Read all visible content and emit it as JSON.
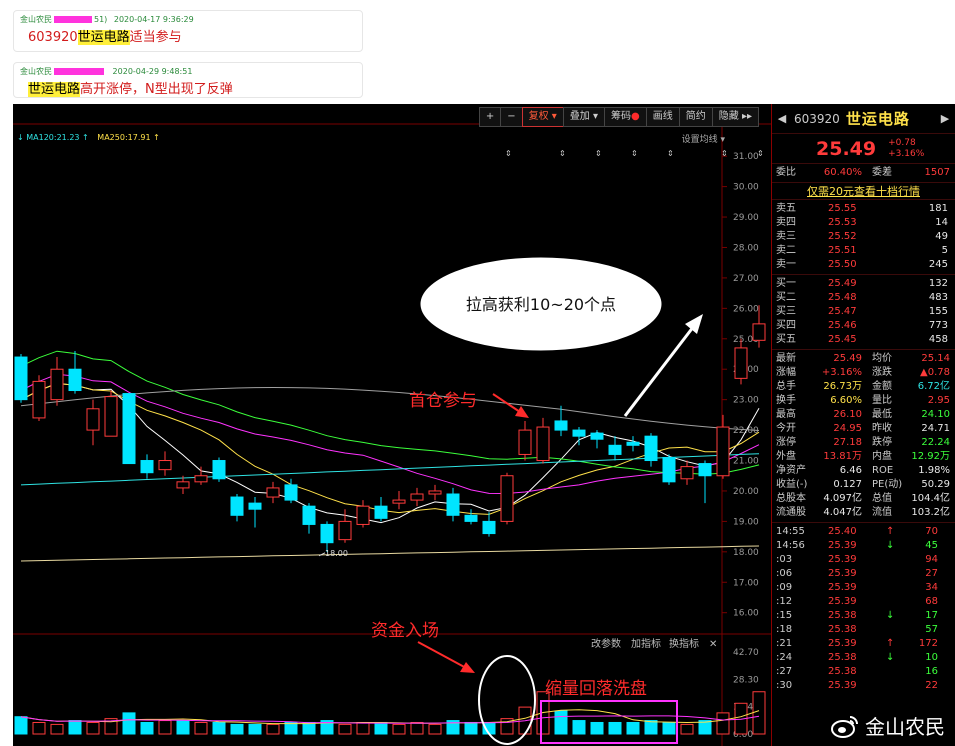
{
  "posts": [
    {
      "author": "金山农民",
      "author_suffix": "51)",
      "datetime": "2020-04-17 9:36:29",
      "code": "603920",
      "highlight": "世运电路",
      "rest": "适当参与"
    },
    {
      "author": "金山农民",
      "author_suffix": "",
      "datetime": "2020-04-29 9:48:51",
      "code": "",
      "highlight": "世运电路",
      "rest": "高开涨停，N型出现了反弹"
    }
  ],
  "toolbar": {
    "plus": "+",
    "minus": "−",
    "fuquan": "复权",
    "diejia": "叠加",
    "chouma": "筹码",
    "huaxian": "画线",
    "jianyue": "简约",
    "yincang": "隐藏"
  },
  "indicators": {
    "ma120": "MA120:21.23",
    "ma250": "MA250:17.91",
    "set_ma": "设置均线"
  },
  "sub_toolbar": {
    "change_params": "改参数",
    "add_indicator": "加指标",
    "switch_indicator": "换指标",
    "close": "✕"
  },
  "annotations": {
    "bubble": "拉高获利10~20个点",
    "first_position": "首仓参与",
    "capital_in": "资金入场",
    "shrink_volume": "缩量回落洗盘",
    "low_label": "18.00"
  },
  "chart_data": {
    "type": "candlestick",
    "price_axis_ticks": [
      "31.00",
      "30.00",
      "29.00",
      "28.00",
      "27.00",
      "26.00",
      "25.00",
      "24.00",
      "23.00",
      "22.00",
      "21.00",
      "20.00",
      "19.00",
      "18.00",
      "17.00",
      "16.00"
    ],
    "volume_axis_ticks": [
      "42.70",
      "28.30",
      "14.40",
      "0.00"
    ],
    "ylim": [
      15.3,
      31.4
    ],
    "candles": [
      {
        "o": 24.4,
        "c": 23.0,
        "h": 24.5,
        "l": 22.9
      },
      {
        "o": 22.4,
        "c": 23.6,
        "h": 23.8,
        "l": 22.3
      },
      {
        "o": 23.0,
        "c": 24.0,
        "h": 24.4,
        "l": 22.8
      },
      {
        "o": 24.0,
        "c": 23.3,
        "h": 24.6,
        "l": 23.2
      },
      {
        "o": 22.0,
        "c": 22.7,
        "h": 23.0,
        "l": 21.5
      },
      {
        "o": 21.8,
        "c": 23.1,
        "h": 23.3,
        "l": 21.8
      },
      {
        "o": 23.2,
        "c": 20.9,
        "h": 23.2,
        "l": 20.9
      },
      {
        "o": 21.0,
        "c": 20.6,
        "h": 21.2,
        "l": 20.4
      },
      {
        "o": 20.7,
        "c": 21.0,
        "h": 21.3,
        "l": 20.5
      },
      {
        "o": 20.1,
        "c": 20.3,
        "h": 20.5,
        "l": 19.9
      },
      {
        "o": 20.3,
        "c": 20.5,
        "h": 20.8,
        "l": 20.2
      },
      {
        "o": 21.0,
        "c": 20.4,
        "h": 21.1,
        "l": 20.3
      },
      {
        "o": 19.8,
        "c": 19.2,
        "h": 19.9,
        "l": 19.0
      },
      {
        "o": 19.6,
        "c": 19.4,
        "h": 19.8,
        "l": 18.8
      },
      {
        "o": 19.8,
        "c": 20.1,
        "h": 20.3,
        "l": 19.6
      },
      {
        "o": 20.2,
        "c": 19.7,
        "h": 20.4,
        "l": 19.6
      },
      {
        "o": 19.5,
        "c": 18.9,
        "h": 19.6,
        "l": 18.6
      },
      {
        "o": 18.9,
        "c": 18.3,
        "h": 19.0,
        "l": 18.0
      },
      {
        "o": 18.4,
        "c": 19.0,
        "h": 19.4,
        "l": 18.3
      },
      {
        "o": 18.9,
        "c": 19.5,
        "h": 19.7,
        "l": 18.8
      },
      {
        "o": 19.5,
        "c": 19.1,
        "h": 19.8,
        "l": 19.0
      },
      {
        "o": 19.6,
        "c": 19.7,
        "h": 20.0,
        "l": 19.4
      },
      {
        "o": 19.7,
        "c": 19.9,
        "h": 20.1,
        "l": 19.5
      },
      {
        "o": 19.9,
        "c": 20.0,
        "h": 20.2,
        "l": 19.7
      },
      {
        "o": 19.9,
        "c": 19.2,
        "h": 20.1,
        "l": 19.0
      },
      {
        "o": 19.2,
        "c": 19.0,
        "h": 19.4,
        "l": 18.9
      },
      {
        "o": 19.0,
        "c": 18.6,
        "h": 19.3,
        "l": 18.5
      },
      {
        "o": 19.0,
        "c": 20.5,
        "h": 20.6,
        "l": 18.9
      },
      {
        "o": 21.2,
        "c": 22.0,
        "h": 22.3,
        "l": 21.0
      },
      {
        "o": 21.0,
        "c": 22.1,
        "h": 22.4,
        "l": 20.9
      },
      {
        "o": 22.3,
        "c": 22.0,
        "h": 22.8,
        "l": 21.8
      },
      {
        "o": 22.0,
        "c": 21.8,
        "h": 22.1,
        "l": 21.5
      },
      {
        "o": 21.9,
        "c": 21.7,
        "h": 22.0,
        "l": 21.4
      },
      {
        "o": 21.5,
        "c": 21.2,
        "h": 21.8,
        "l": 21.0
      },
      {
        "o": 21.6,
        "c": 21.5,
        "h": 21.8,
        "l": 21.3
      },
      {
        "o": 21.8,
        "c": 21.0,
        "h": 21.9,
        "l": 20.8
      },
      {
        "o": 21.1,
        "c": 20.3,
        "h": 21.2,
        "l": 20.2
      },
      {
        "o": 20.4,
        "c": 20.8,
        "h": 21.0,
        "l": 20.2
      },
      {
        "o": 20.9,
        "c": 20.5,
        "h": 21.0,
        "l": 19.6
      },
      {
        "o": 20.5,
        "c": 22.1,
        "h": 22.5,
        "l": 20.4
      },
      {
        "o": 23.7,
        "c": 24.7,
        "h": 25.0,
        "l": 23.5
      },
      {
        "o": 24.95,
        "c": 25.49,
        "h": 26.1,
        "l": 24.71
      }
    ],
    "volumes": [
      {
        "v": 9,
        "up": false
      },
      {
        "v": 6,
        "up": true
      },
      {
        "v": 5,
        "up": true
      },
      {
        "v": 7,
        "up": false
      },
      {
        "v": 6,
        "up": true
      },
      {
        "v": 8,
        "up": true
      },
      {
        "v": 11,
        "up": false
      },
      {
        "v": 6,
        "up": false
      },
      {
        "v": 7,
        "up": true
      },
      {
        "v": 7,
        "up": false
      },
      {
        "v": 6,
        "up": true
      },
      {
        "v": 6,
        "up": false
      },
      {
        "v": 5,
        "up": false
      },
      {
        "v": 5,
        "up": false
      },
      {
        "v": 5,
        "up": true
      },
      {
        "v": 6,
        "up": false
      },
      {
        "v": 6,
        "up": false
      },
      {
        "v": 7,
        "up": false
      },
      {
        "v": 5,
        "up": true
      },
      {
        "v": 6,
        "up": true
      },
      {
        "v": 6,
        "up": false
      },
      {
        "v": 5,
        "up": true
      },
      {
        "v": 6,
        "up": true
      },
      {
        "v": 5,
        "up": true
      },
      {
        "v": 7,
        "up": false
      },
      {
        "v": 6,
        "up": false
      },
      {
        "v": 6,
        "up": false
      },
      {
        "v": 8,
        "up": true
      },
      {
        "v": 14,
        "up": true
      },
      {
        "v": 22,
        "up": true
      },
      {
        "v": 12,
        "up": false
      },
      {
        "v": 7,
        "up": false
      },
      {
        "v": 6,
        "up": false
      },
      {
        "v": 6,
        "up": false
      },
      {
        "v": 6,
        "up": false
      },
      {
        "v": 7,
        "up": false
      },
      {
        "v": 6,
        "up": false
      },
      {
        "v": 5,
        "up": true
      },
      {
        "v": 7,
        "up": false
      },
      {
        "v": 11,
        "up": true
      },
      {
        "v": 16,
        "up": true
      },
      {
        "v": 22,
        "up": true
      }
    ]
  },
  "panel": {
    "code": "603920",
    "name": "世运电路",
    "price": "25.49",
    "change": "+0.78",
    "change_pct": "+3.16%",
    "weibi_label": "委比",
    "weibi": "60.40%",
    "weicha_label": "委差",
    "weicha": "1507",
    "banner": "仅需20元查看十档行情",
    "asks": [
      {
        "label": "卖五",
        "price": "25.55",
        "vol": "181"
      },
      {
        "label": "卖四",
        "price": "25.53",
        "vol": "14"
      },
      {
        "label": "卖三",
        "price": "25.52",
        "vol": "49"
      },
      {
        "label": "卖二",
        "price": "25.51",
        "vol": "5"
      },
      {
        "label": "卖一",
        "price": "25.50",
        "vol": "245"
      }
    ],
    "bids": [
      {
        "label": "买一",
        "price": "25.49",
        "vol": "132"
      },
      {
        "label": "买二",
        "price": "25.48",
        "vol": "483"
      },
      {
        "label": "买三",
        "price": "25.47",
        "vol": "155"
      },
      {
        "label": "买四",
        "price": "25.46",
        "vol": "773"
      },
      {
        "label": "买五",
        "price": "25.45",
        "vol": "458"
      }
    ],
    "stats": [
      {
        "l1": "最新",
        "v1": "25.49",
        "c1": "red",
        "l2": "均价",
        "v2": "25.14",
        "c2": "red"
      },
      {
        "l1": "涨幅",
        "v1": "+3.16%",
        "c1": "red",
        "l2": "涨跌",
        "v2": "▲0.78",
        "c2": "red"
      },
      {
        "l1": "总手",
        "v1": "26.73万",
        "c1": "yellow",
        "l2": "金额",
        "v2": "6.72亿",
        "c2": "cyan"
      },
      {
        "l1": "换手",
        "v1": "6.60%",
        "c1": "yellow",
        "l2": "量比",
        "v2": "2.95",
        "c2": "red"
      },
      {
        "l1": "最高",
        "v1": "26.10",
        "c1": "red",
        "l2": "最低",
        "v2": "24.10",
        "c2": "green"
      },
      {
        "l1": "今开",
        "v1": "24.95",
        "c1": "red",
        "l2": "昨收",
        "v2": "24.71",
        "c2": "white"
      },
      {
        "l1": "涨停",
        "v1": "27.18",
        "c1": "red",
        "l2": "跌停",
        "v2": "22.24",
        "c2": "green"
      },
      {
        "l1": "外盘",
        "v1": "13.81万",
        "c1": "red",
        "l2": "内盘",
        "v2": "12.92万",
        "c2": "green"
      },
      {
        "l1": "净资产",
        "v1": "6.46",
        "c1": "white",
        "l2": "ROE",
        "v2": "1.98%",
        "c2": "white"
      },
      {
        "l1": "收益(-)",
        "v1": "0.127",
        "c1": "white",
        "l2": "PE(动)",
        "v2": "50.29",
        "c2": "white"
      },
      {
        "l1": "总股本",
        "v1": "4.097亿",
        "c1": "white",
        "l2": "总值",
        "v2": "104.4亿",
        "c2": "white"
      },
      {
        "l1": "流通股",
        "v1": "4.047亿",
        "c1": "white",
        "l2": "流值",
        "v2": "103.2亿",
        "c2": "white"
      }
    ],
    "ticks": [
      {
        "t": "14:55",
        "p": "25.40",
        "a": "↑",
        "ac": "red",
        "v": "70",
        "vc": "red"
      },
      {
        "t": "14:56",
        "p": "25.39",
        "a": "↓",
        "ac": "green",
        "v": "45",
        "vc": "green"
      },
      {
        "t": ":03",
        "p": "25.39",
        "a": "",
        "ac": "red",
        "v": "94",
        "vc": "red"
      },
      {
        "t": ":06",
        "p": "25.39",
        "a": "",
        "ac": "red",
        "v": "27",
        "vc": "red"
      },
      {
        "t": ":09",
        "p": "25.39",
        "a": "",
        "ac": "red",
        "v": "34",
        "vc": "red"
      },
      {
        "t": ":12",
        "p": "25.39",
        "a": "",
        "ac": "red",
        "v": "68",
        "vc": "red"
      },
      {
        "t": ":15",
        "p": "25.38",
        "a": "↓",
        "ac": "green",
        "v": "17",
        "vc": "green"
      },
      {
        "t": ":18",
        "p": "25.38",
        "a": "",
        "ac": "red",
        "v": "57",
        "vc": "green"
      },
      {
        "t": ":21",
        "p": "25.39",
        "a": "↑",
        "ac": "red",
        "v": "172",
        "vc": "red"
      },
      {
        "t": ":24",
        "p": "25.38",
        "a": "↓",
        "ac": "green",
        "v": "10",
        "vc": "green"
      },
      {
        "t": ":27",
        "p": "25.38",
        "a": "",
        "ac": "red",
        "v": "16",
        "vc": "green"
      },
      {
        "t": ":30",
        "p": "25.39",
        "a": "",
        "ac": "red",
        "v": "22",
        "vc": "red"
      }
    ]
  },
  "watermark": "金山农民",
  "colors": {
    "up": "#ff3b3b",
    "down": "#00e5ff",
    "bg": "#000000",
    "highlight": "#ffef3a"
  }
}
